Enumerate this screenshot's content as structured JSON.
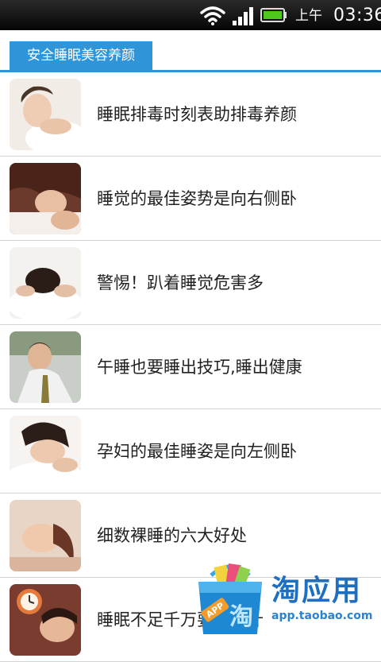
{
  "status_bar": {
    "am_pm": "上午",
    "time": "03:36",
    "wifi_icon": "wifi-icon",
    "signal_icon": "signal-bars-icon",
    "battery_icon": "battery-icon",
    "battery_color": "#4fc81e"
  },
  "tab": {
    "label": "安全睡眠美容养颜",
    "color": "#2f94d8"
  },
  "articles": [
    {
      "title": "睡眠排毒时刻表助排毒养颜",
      "thumbnail": "sleeping-woman-photo"
    },
    {
      "title": "睡觉的最佳姿势是向右侧卧",
      "thumbnail": "sleeping-woman-photo"
    },
    {
      "title": "警惕！趴着睡觉危害多",
      "thumbnail": "sleeping-woman-photo"
    },
    {
      "title": "午睡也要睡出技巧,睡出健康",
      "thumbnail": "napping-man-photo"
    },
    {
      "title": "孕妇的最佳睡姿是向左侧卧",
      "thumbnail": "sleeping-woman-photo"
    },
    {
      "title": "细数裸睡的六大好处",
      "thumbnail": "sleeping-woman-photo"
    },
    {
      "title": "睡眠不足千万要注意什",
      "thumbnail": "sleeping-woman-clock-photo"
    }
  ],
  "watermark": {
    "name": "淘应用",
    "url": "app.taobao.com",
    "bag_badge": "APP",
    "bag_char": "淘"
  }
}
